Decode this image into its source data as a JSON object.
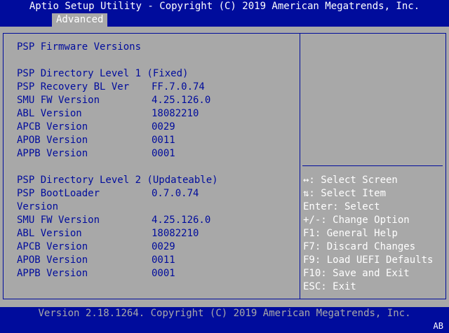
{
  "header": {
    "title": "Aptio Setup Utility - Copyright (C) 2019 American Megatrends, Inc.",
    "active_tab": "Advanced"
  },
  "main": {
    "section_title": "PSP Firmware Versions",
    "level1": {
      "heading": "PSP Directory Level 1 (Fixed)",
      "rows": [
        {
          "label": "PSP Recovery BL Ver",
          "value": "FF.7.0.74"
        },
        {
          "label": "SMU FW Version",
          "value": "4.25.126.0"
        },
        {
          "label": "ABL Version",
          "value": "18082210"
        },
        {
          "label": "APCB Version",
          "value": "0029"
        },
        {
          "label": "APOB Version",
          "value": "0011"
        },
        {
          "label": "APPB Version",
          "value": "0001"
        }
      ]
    },
    "level2": {
      "heading": "PSP Directory Level 2 (Updateable)",
      "bootloader_label_1": "PSP BootLoader",
      "bootloader_label_2": "Version",
      "bootloader_value": "0.7.0.74",
      "rows": [
        {
          "label": "SMU FW Version",
          "value": "4.25.126.0"
        },
        {
          "label": "ABL Version",
          "value": "18082210"
        },
        {
          "label": "APCB Version",
          "value": "0029"
        },
        {
          "label": "APOB Version",
          "value": "0011"
        },
        {
          "label": "APPB Version",
          "value": "0001"
        }
      ]
    }
  },
  "help": {
    "items": [
      {
        "key": "↔:",
        "desc": " Select Screen"
      },
      {
        "key": "⇅:",
        "desc": " Select Item"
      },
      {
        "key": "Enter:",
        "desc": " Select"
      },
      {
        "key": "+/-:",
        "desc": " Change Option"
      },
      {
        "key": "F1:",
        "desc": " General Help"
      },
      {
        "key": "F7:",
        "desc": " Discard Changes"
      },
      {
        "key": "F9:",
        "desc": " Load UEFI Defaults"
      },
      {
        "key": "F10:",
        "desc": " Save and Exit"
      },
      {
        "key": "ESC:",
        "desc": " Exit"
      }
    ]
  },
  "footer": {
    "version": "Version 2.18.1264. Copyright (C) 2019 American Megatrends, Inc.",
    "corner": "AB"
  },
  "colors": {
    "background": "#000c9c",
    "panel": "#a8a8a8",
    "text_main": "#000c9c",
    "text_help": "#ffffff"
  }
}
